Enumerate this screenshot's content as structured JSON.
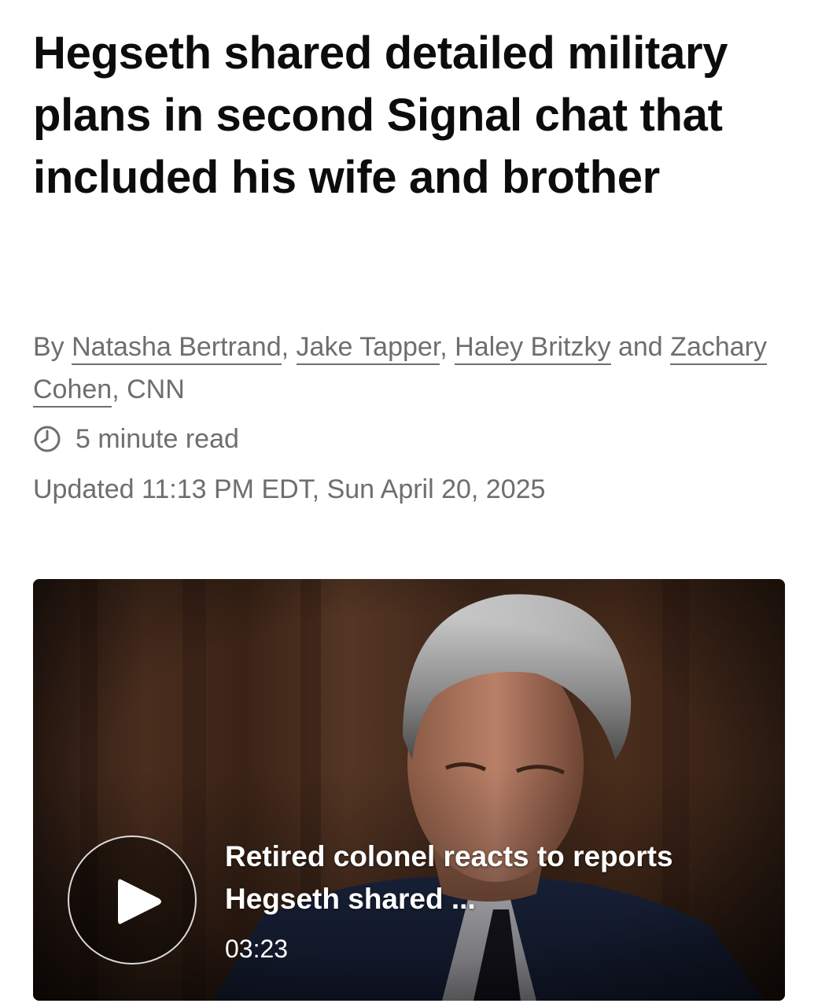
{
  "article": {
    "headline": "Hegseth shared detailed military plans in second Signal chat that included his wife and brother",
    "byline": {
      "prefix": "By ",
      "authors": [
        "Natasha Bertrand",
        "Jake Tapper",
        "Haley Britzky",
        "Zachary Cohen"
      ],
      "sep1": ", ",
      "sep2": ", ",
      "sep3": " and ",
      "suffix": ", CNN"
    },
    "read_time": "5 minute read",
    "updated": "Updated 11:13 PM EDT, Sun April 20, 2025"
  },
  "video": {
    "title": "Retired colonel reacts to reports Hegseth shared ...",
    "duration": "03:23",
    "play_icon": "play-icon"
  },
  "icons": {
    "clock": "clock-icon"
  },
  "colors": {
    "headline": "#0c0c0c",
    "meta_text": "#6e6e6e",
    "video_text": "#ffffff"
  }
}
